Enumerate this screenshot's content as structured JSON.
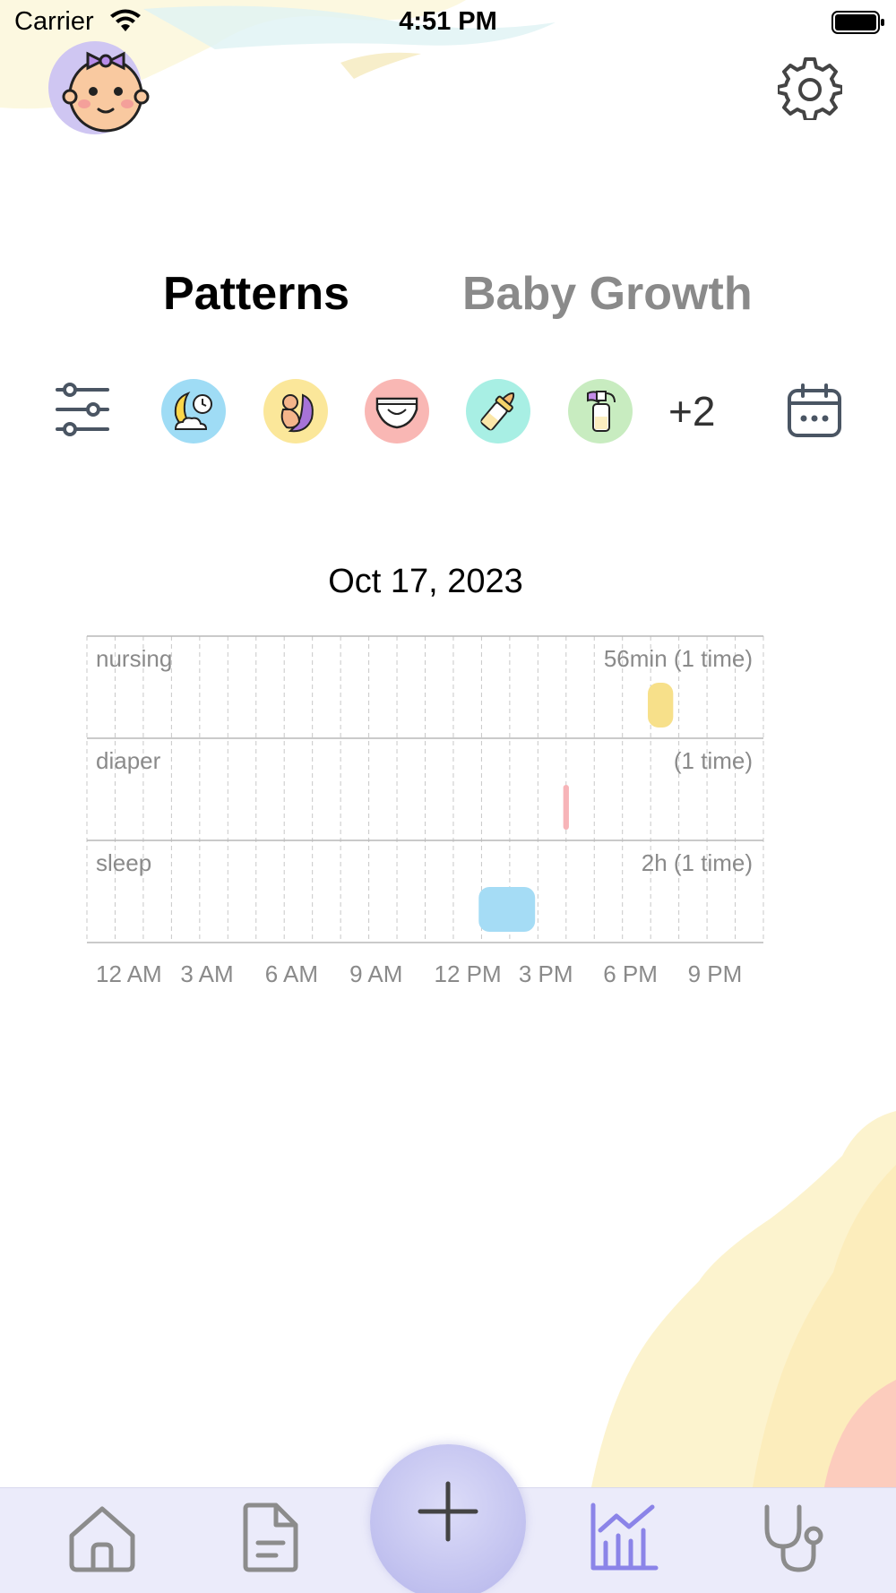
{
  "status_bar": {
    "carrier": "Carrier",
    "time": "4:51 PM"
  },
  "header": {
    "avatar_icon": "baby-girl-avatar-icon",
    "settings_icon": "gear-icon"
  },
  "tabs": [
    {
      "label": "Patterns",
      "selected": true
    },
    {
      "label": "Baby Growth",
      "selected": false
    }
  ],
  "filter_bar": {
    "filter_icon": "sliders-icon",
    "categories": [
      {
        "name": "sleep",
        "icon": "moon-clock-icon",
        "color": "#9fdcf5"
      },
      {
        "name": "nursing",
        "icon": "nursing-icon",
        "color": "#fbe79a"
      },
      {
        "name": "diaper",
        "icon": "diaper-icon",
        "color": "#f9b7b4"
      },
      {
        "name": "bottle",
        "icon": "bottle-icon",
        "color": "#a8efe4"
      },
      {
        "name": "pump",
        "icon": "breast-pump-icon",
        "color": "#c8ecc0"
      }
    ],
    "more_count": "+2",
    "calendar_icon": "calendar-icon"
  },
  "chart_data": {
    "type": "timeline",
    "title": "Oct 17, 2023",
    "x_range_hours": [
      0,
      24
    ],
    "x_tick_labels": [
      "12 AM",
      "3 AM",
      "6 AM",
      "9 AM",
      "12 PM",
      "3 PM",
      "6 PM",
      "9 PM"
    ],
    "grid": "dashed vertical every hour",
    "rows": [
      {
        "label": "nursing",
        "summary": "56min (1 time)",
        "color": "#f7e08a",
        "events": [
          {
            "start_hour": 19.9,
            "end_hour": 20.8
          }
        ]
      },
      {
        "label": "diaper",
        "summary": "(1 time)",
        "color": "#f7b4b8",
        "events": [
          {
            "start_hour": 16.9,
            "end_hour": 17.1
          }
        ]
      },
      {
        "label": "sleep",
        "summary": "2h (1 time)",
        "color": "#a5dcf5",
        "events": [
          {
            "start_hour": 13.9,
            "end_hour": 15.9
          }
        ]
      }
    ]
  },
  "bottom_nav": {
    "items": [
      {
        "name": "home",
        "icon": "home-icon",
        "active": false
      },
      {
        "name": "log",
        "icon": "document-icon",
        "active": false
      },
      {
        "name": "add",
        "icon": "plus-icon",
        "active": false
      },
      {
        "name": "charts",
        "icon": "bar-chart-icon",
        "active": true
      },
      {
        "name": "health",
        "icon": "stethoscope-icon",
        "active": false
      }
    ],
    "active_color": "#8b84e8",
    "inactive_color": "#8c8c8c"
  }
}
